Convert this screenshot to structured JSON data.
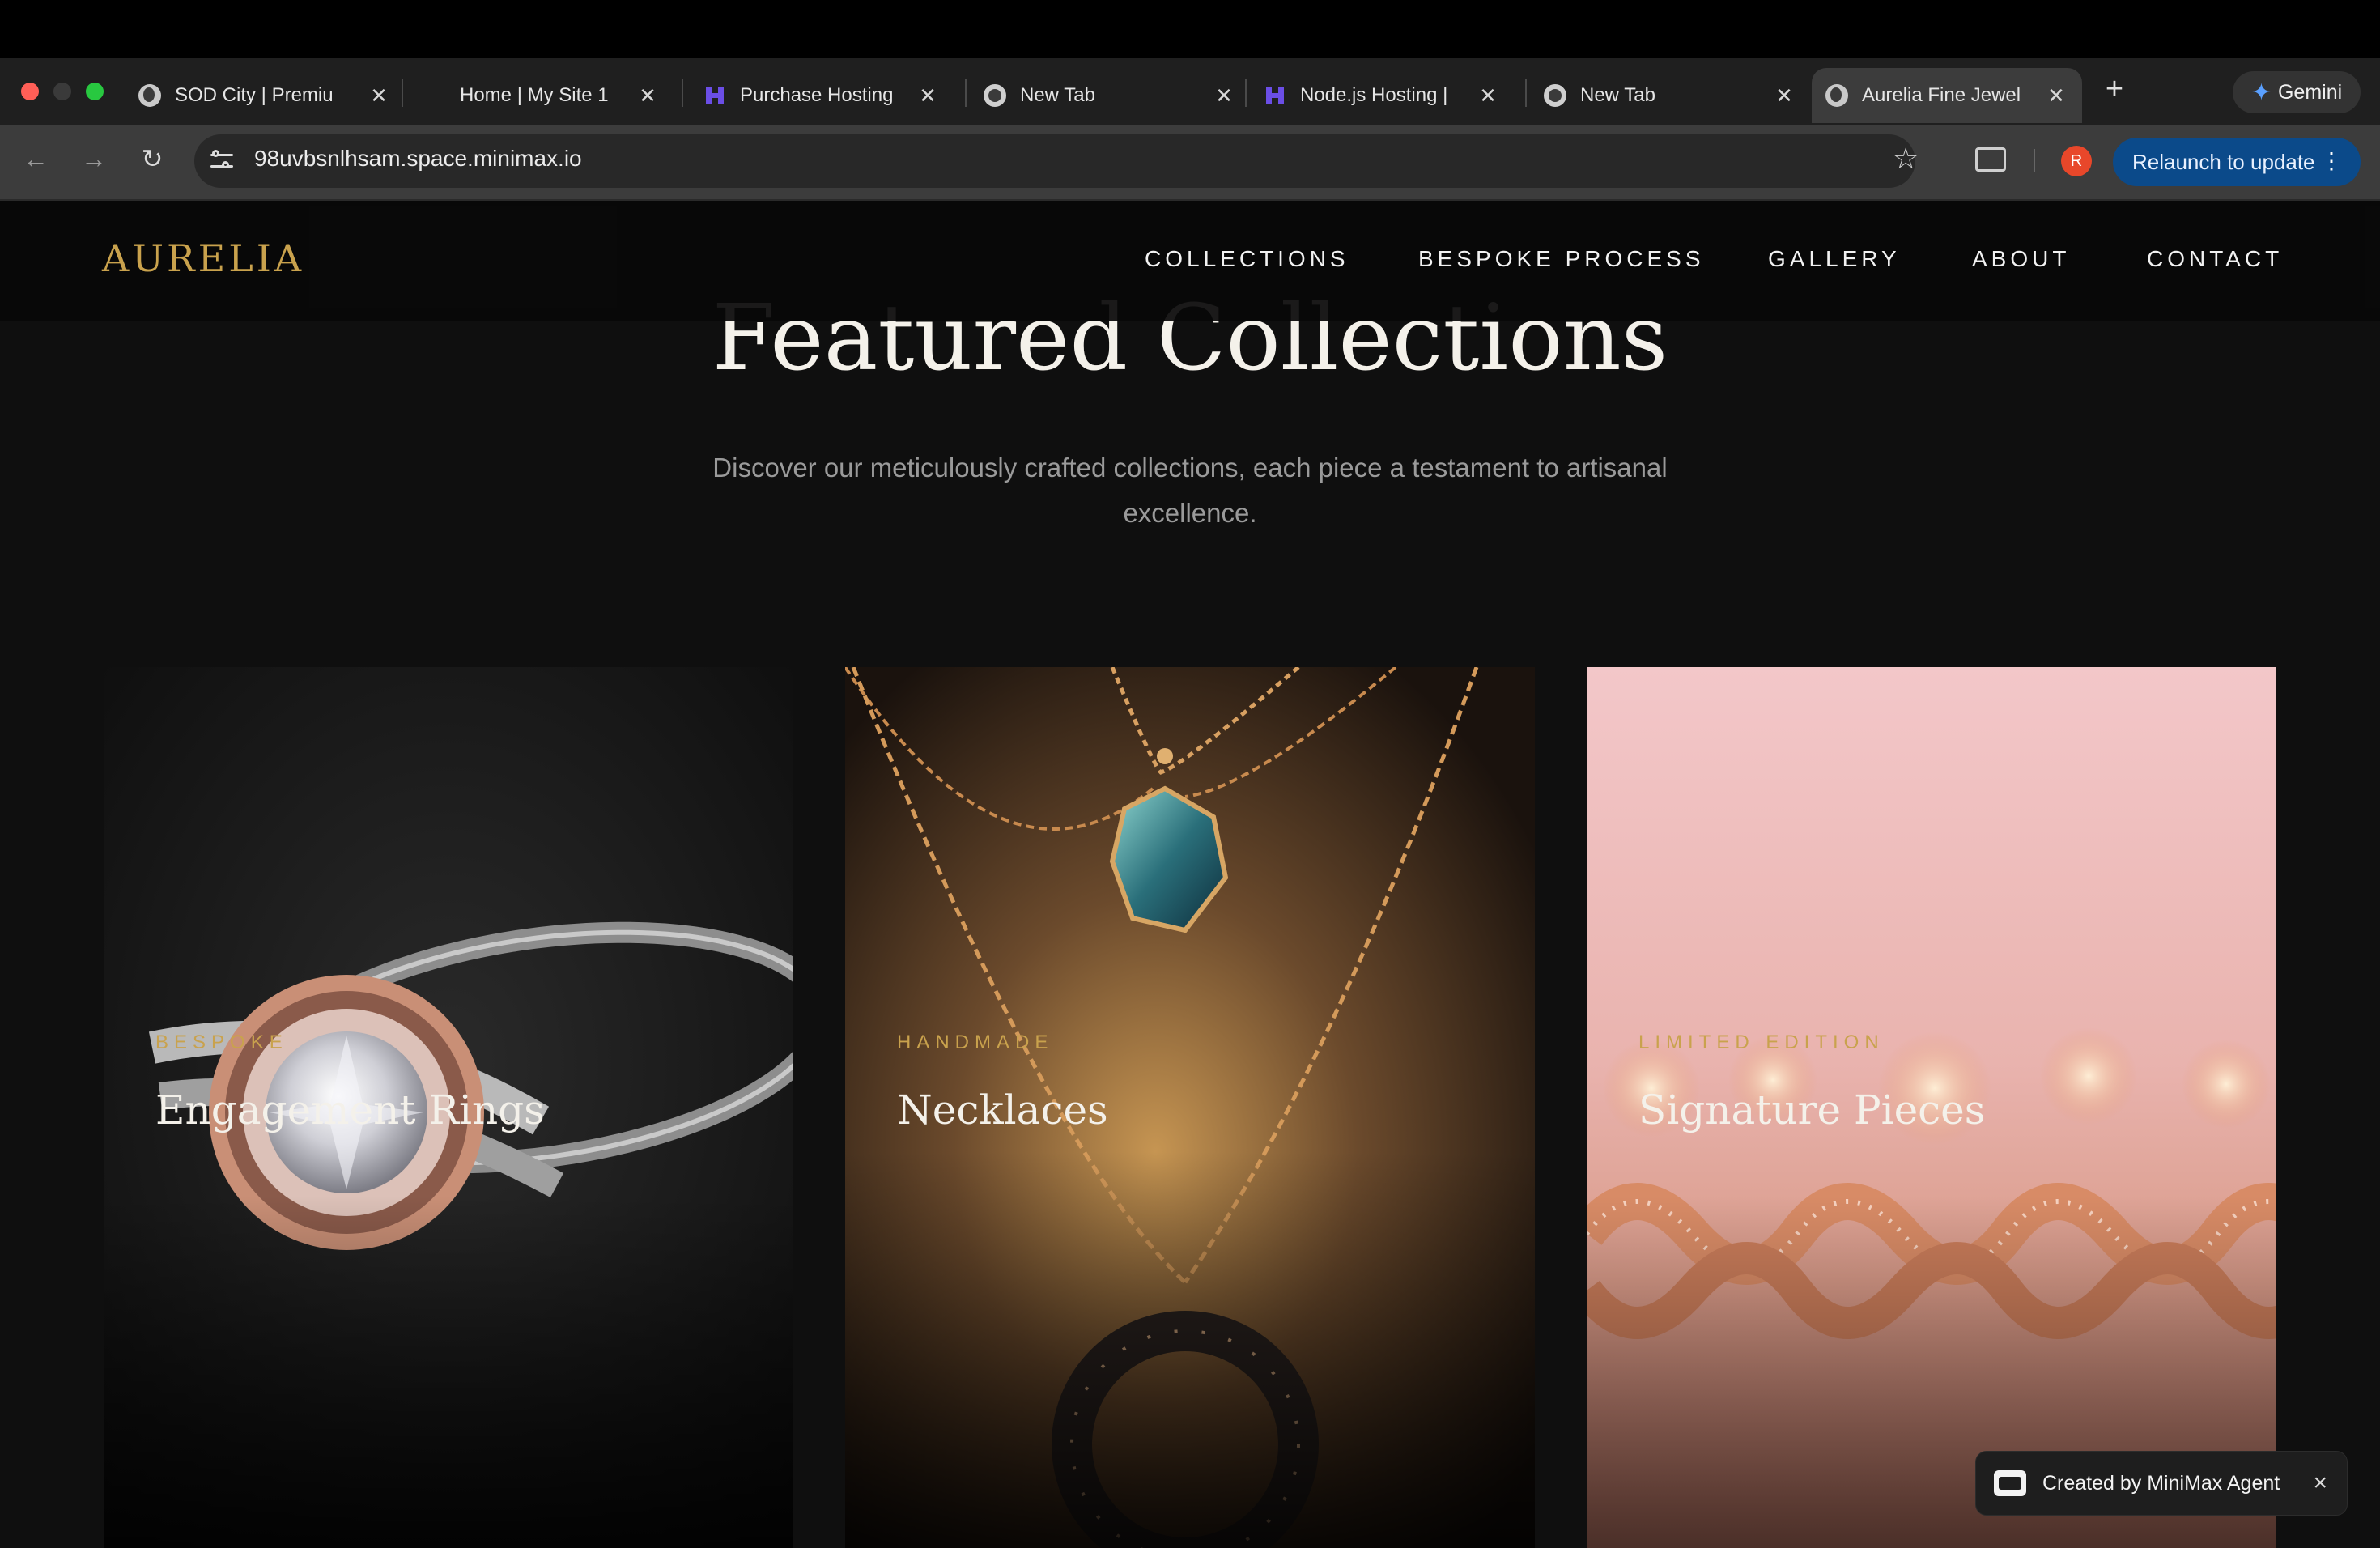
{
  "browser": {
    "tabs": [
      {
        "title": "SOD City | Premiu",
        "favicon": "globe-icon"
      },
      {
        "title": "Home | My Site 1",
        "favicon": "none"
      },
      {
        "title": "Purchase Hosting",
        "favicon": "hostinger-icon"
      },
      {
        "title": "New Tab",
        "favicon": "chrome-icon"
      },
      {
        "title": "Node.js Hosting | ",
        "favicon": "hostinger-icon"
      },
      {
        "title": "New Tab",
        "favicon": "chrome-icon"
      },
      {
        "title": "Aurelia Fine Jewel",
        "favicon": "globe-icon",
        "active": true
      }
    ],
    "gemini_label": "Gemini",
    "url": "98uvbsnlhsam.space.minimax.io",
    "avatar_initial": "R",
    "relaunch_label": "Relaunch to update"
  },
  "site": {
    "logo": "AURELIA",
    "nav": [
      "COLLECTIONS",
      "BESPOKE PROCESS",
      "GALLERY",
      "ABOUT",
      "CONTACT"
    ],
    "section_title": "Featured Collections",
    "section_subtitle": "Discover our meticulously crafted collections, each piece a testament to artisanal excellence.",
    "cards": [
      {
        "eyebrow": "BESPOKE",
        "title": "Engagement Rings"
      },
      {
        "eyebrow": "HANDMADE",
        "title": "Necklaces"
      },
      {
        "eyebrow": "LIMITED EDITION",
        "title": "Signature Pieces"
      }
    ]
  },
  "badge": {
    "label": "Created by MiniMax Agent"
  },
  "colors": {
    "gold": "#c9a24d",
    "page_bg": "#0f0f0f",
    "relaunch_bg": "#0b4a8a"
  }
}
